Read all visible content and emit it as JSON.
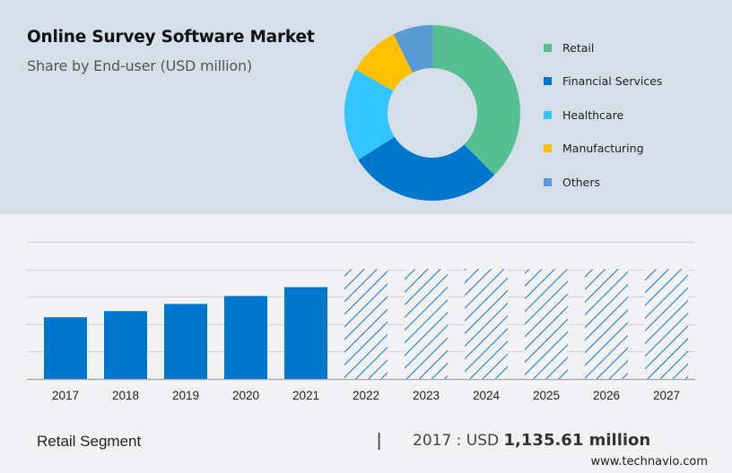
{
  "header": {
    "title": "Online Survey Software Market",
    "subtitle": "Share by End-user (USD million)"
  },
  "chart_data": [
    {
      "type": "pie",
      "variant": "donut",
      "title": "Online Survey Software Market",
      "subtitle": "Share by End-user (USD million)",
      "legend_position": "right",
      "slices": [
        {
          "label": "Retail",
          "value": 37.5,
          "color": "#55bf94"
        },
        {
          "label": "Financial Services",
          "value": 28.5,
          "color": "#0077cf"
        },
        {
          "label": "Healthcare",
          "value": 17.2,
          "color": "#33c5fd"
        },
        {
          "label": "Manufacturing",
          "value": 9.5,
          "color": "#ffc000"
        },
        {
          "label": "Others",
          "value": 7.3,
          "color": "#5b9bd5"
        }
      ],
      "units": "approximate share %"
    },
    {
      "type": "bar",
      "categories": [
        "2017",
        "2018",
        "2019",
        "2020",
        "2021",
        "2022",
        "2023",
        "2024",
        "2025",
        "2026",
        "2027"
      ],
      "series": [
        {
          "name": "Retail Segment",
          "values": [
            1135.61,
            1250,
            1381,
            1528,
            1691,
            2025,
            2025,
            2025,
            2025,
            2025,
            2025
          ],
          "forecast_from_index": 5,
          "color": "#0077cf"
        }
      ],
      "xlabel": "",
      "ylabel": "",
      "ylim": [
        0,
        2525
      ],
      "gridlines": [
        0,
        505,
        1010,
        1515,
        2020,
        2525
      ],
      "grid": true,
      "y_tick_labels_visible": false,
      "forecast_style": "hatched"
    }
  ],
  "footer": {
    "segment_label": "Retail Segment",
    "separator": "|",
    "value_prefix": "2017 : USD ",
    "value_bold": "1,135.61 million",
    "source": "www.technavio.com"
  }
}
